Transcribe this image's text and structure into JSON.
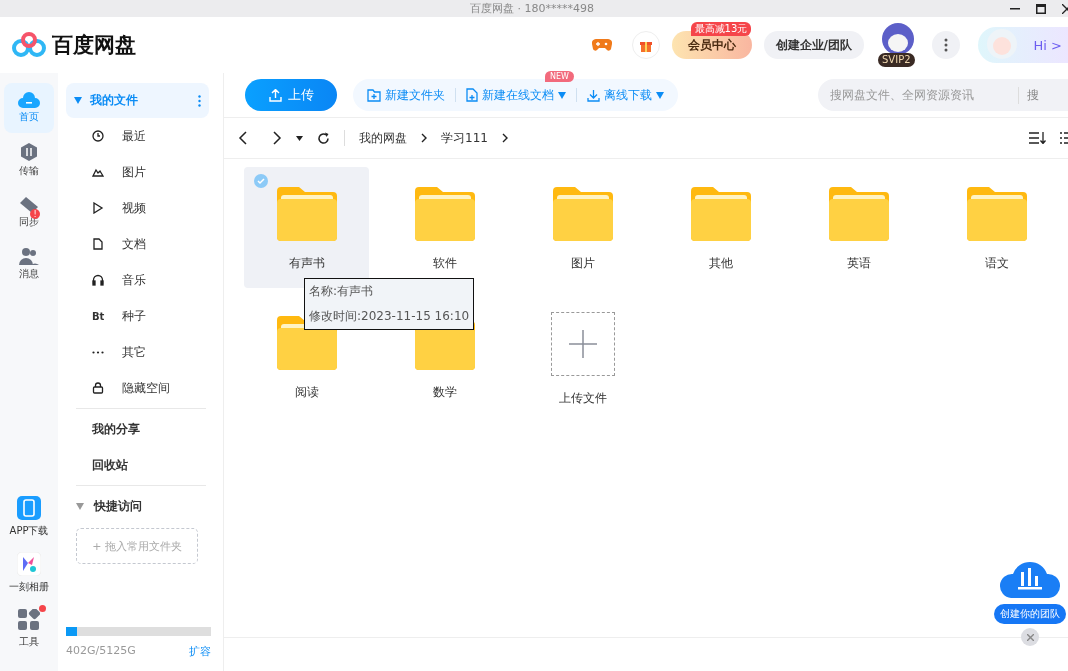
{
  "window": {
    "title": "百度网盘",
    "separator": "·",
    "account": "180*****498"
  },
  "header": {
    "app_name": "百度网盘",
    "vip": {
      "label": "会员中心",
      "badge": "最高减13元"
    },
    "team_button": "创建企业/团队",
    "level_badge": "SVIP2",
    "hi_button": "Hi >"
  },
  "rail": [
    {
      "label": "首页",
      "selected": true,
      "kind": "home"
    },
    {
      "label": "传输",
      "selected": false,
      "kind": "transfer"
    },
    {
      "label": "同步",
      "selected": false,
      "kind": "sync",
      "badge": "!"
    },
    {
      "label": "消息",
      "selected": false,
      "kind": "message"
    }
  ],
  "rail_bottom": [
    {
      "label": "APP下载",
      "kind": "phone",
      "dot": false
    },
    {
      "label": "一刻相册",
      "kind": "album",
      "dot": false
    },
    {
      "label": "工具",
      "kind": "tools",
      "dot": true
    }
  ],
  "nav": {
    "title": "我的文件",
    "selected": true,
    "expanded": true,
    "items": [
      {
        "label": "最近",
        "kind": "clock"
      },
      {
        "label": "图片",
        "kind": "image"
      },
      {
        "label": "视频",
        "kind": "play"
      },
      {
        "label": "文档",
        "kind": "doc"
      },
      {
        "label": "音乐",
        "kind": "music"
      },
      {
        "label": "种子",
        "kind": "bt",
        "glyph": "Bt"
      },
      {
        "label": "其它",
        "kind": "more"
      },
      {
        "label": "隐藏空间",
        "kind": "lock"
      }
    ],
    "links": [
      "我的分享",
      "回收站"
    ],
    "quick_access": {
      "title": "快捷访问",
      "expanded": true,
      "drop_hint": "+ 拖入常用文件夹"
    },
    "storage": {
      "level": 0.078,
      "usage": "402G/5125G",
      "expand": "扩容"
    }
  },
  "toolbar": {
    "upload": "上传",
    "new_folder": "新建文件夹",
    "new_doc": "新建在线文档",
    "new_badge": "NEW",
    "offline": "离线下载",
    "search": {
      "placeholder": "搜网盘文件、全网资源资讯"
    },
    "search_button": "搜"
  },
  "breadcrumb": [
    "我的网盘",
    "学习111"
  ],
  "files": [
    {
      "name": "有声书",
      "selected": true
    },
    {
      "name": "软件",
      "selected": false
    },
    {
      "name": "图片",
      "selected": false
    },
    {
      "name": "其他",
      "selected": false
    },
    {
      "name": "英语",
      "selected": false
    },
    {
      "name": "语文",
      "selected": false
    },
    {
      "name": "阅读",
      "selected": false
    },
    {
      "name": "数学",
      "selected": false
    }
  ],
  "upload_tile": "上传文件",
  "tooltip": {
    "name": "名称:有声书",
    "modified": "修改时间:2023-11-15 16:10"
  },
  "promo": {
    "label": "创建你的团队"
  }
}
